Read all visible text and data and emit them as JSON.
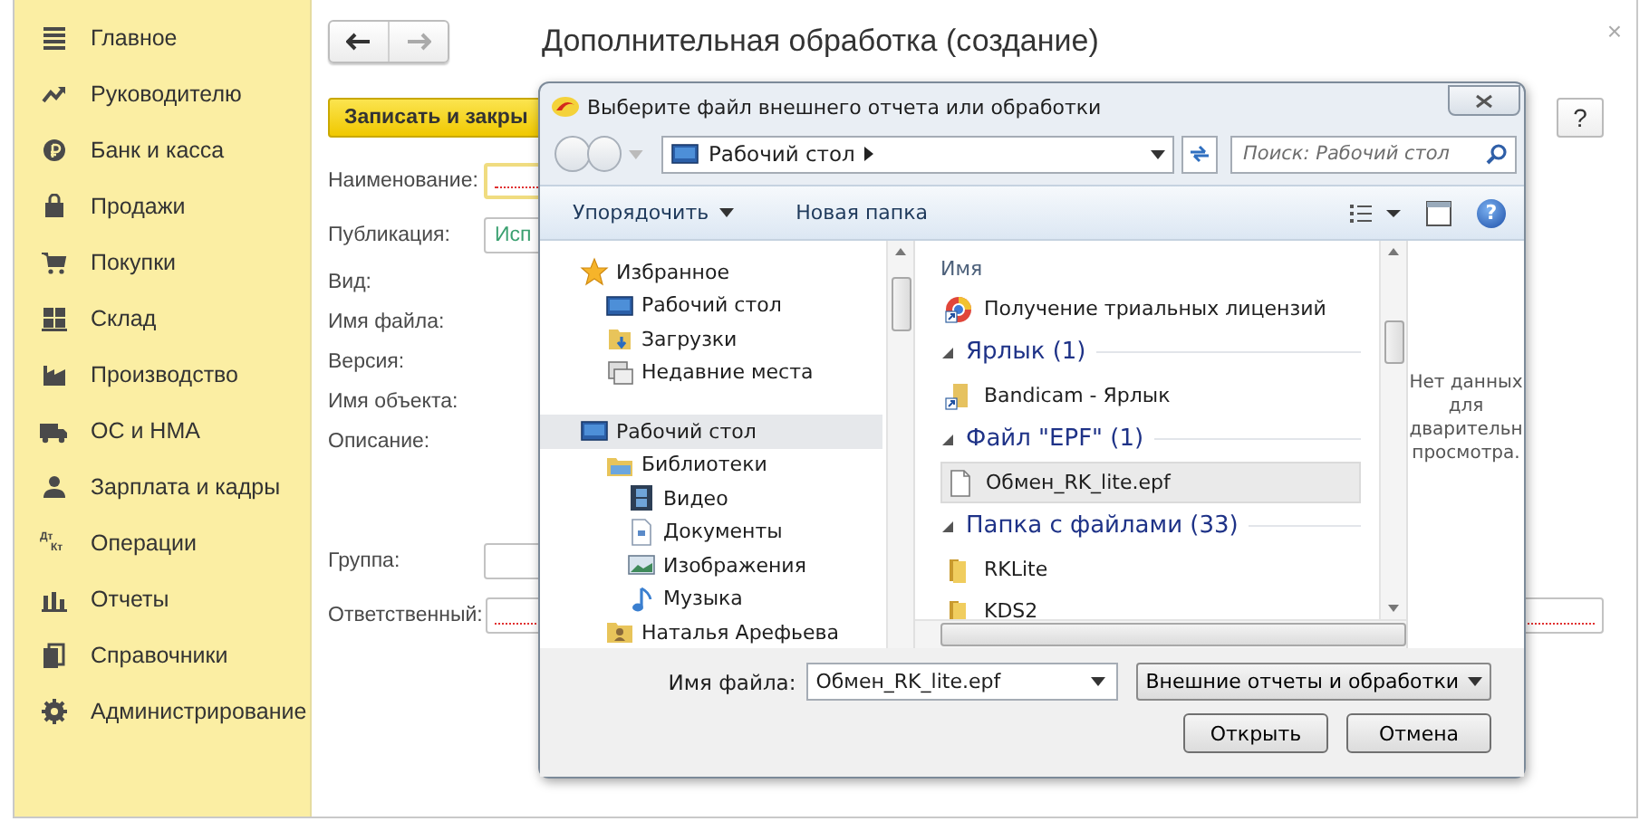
{
  "sidebar": {
    "items": [
      {
        "kind": "menu",
        "label": "Главное"
      },
      {
        "kind": "trend",
        "label": "Руководителю"
      },
      {
        "kind": "coin",
        "label": "Банк и касса"
      },
      {
        "kind": "bag",
        "label": "Продажи"
      },
      {
        "kind": "cart",
        "label": "Покупки"
      },
      {
        "kind": "grid",
        "label": "Склад"
      },
      {
        "kind": "factory",
        "label": "Производство"
      },
      {
        "kind": "truck",
        "label": "ОС и НМА"
      },
      {
        "kind": "person",
        "label": "Зарплата и кадры"
      },
      {
        "kind": "debit-credit",
        "label": "Операции",
        "icon_text": [
          "Дт",
          "Кт"
        ]
      },
      {
        "kind": "bars",
        "label": "Отчеты"
      },
      {
        "kind": "books",
        "label": "Справочники"
      },
      {
        "kind": "gear",
        "label": "Администрирование"
      }
    ]
  },
  "form": {
    "title": "Дополнительная обработка (создание)",
    "close": "×",
    "save_button": "Записать и закры",
    "help_button": "?",
    "fields": [
      {
        "kind": "input",
        "label": "Наименование:",
        "focused": true,
        "required": true
      },
      {
        "kind": "input",
        "label": "Публикация:",
        "value": "Исп",
        "focused": false,
        "required": false
      },
      {
        "kind": "label",
        "label": "Вид:"
      },
      {
        "kind": "label",
        "label": "Имя файла:"
      },
      {
        "kind": "label",
        "label": "Версия:"
      },
      {
        "kind": "label",
        "label": "Имя объекта:"
      },
      {
        "kind": "label",
        "label": "Описание:"
      },
      {
        "kind": "input",
        "label": "Группа:",
        "focused": false,
        "required": false
      },
      {
        "kind": "input",
        "label": "Ответственный:",
        "focused": false,
        "required": true
      }
    ]
  },
  "dialog": {
    "title": "Выберите файл внешнего отчета или обработки",
    "address": "Рабочий стол",
    "search_placeholder": "Поиск: Рабочий стол",
    "toolbar": {
      "organize": "Упорядочить",
      "new_folder": "Новая папка",
      "help": "?"
    },
    "nav": [
      {
        "kind": "favorites",
        "label": "Избранное",
        "selected": false,
        "children": [
          {
            "kind": "desktop",
            "label": "Рабочий стол",
            "selected": false
          },
          {
            "kind": "downloads",
            "label": "Загрузки",
            "selected": false
          },
          {
            "kind": "recent",
            "label": "Недавние места",
            "selected": false
          }
        ]
      },
      {
        "kind": "desktop",
        "label": "Рабочий стол",
        "selected": true,
        "children": [
          {
            "kind": "libraries",
            "label": "Библиотеки",
            "selected": false,
            "children": [
              {
                "kind": "video",
                "label": "Видео",
                "selected": false
              },
              {
                "kind": "documents",
                "label": "Документы",
                "selected": false
              },
              {
                "kind": "pictures",
                "label": "Изображения",
                "selected": false
              },
              {
                "kind": "music",
                "label": "Музыка",
                "selected": false
              }
            ]
          },
          {
            "kind": "user",
            "label": "Наталья Арефьева",
            "selected": false
          }
        ]
      }
    ],
    "list_header": "Имя",
    "list": [
      {
        "kind": "web-shortcut",
        "label": "Получение триальных лицензий",
        "selected": false
      },
      {
        "kind": "group",
        "label": "Ярлык (1)",
        "expanded": true,
        "children": [
          {
            "kind": "shortcut",
            "label": "Bandicam - Ярлык",
            "selected": false
          }
        ]
      },
      {
        "kind": "group",
        "label": "Файл \"EPF\" (1)",
        "expanded": true,
        "children": [
          {
            "kind": "document",
            "label": "Обмен_RK_lite.epf",
            "selected": true
          }
        ]
      },
      {
        "kind": "group",
        "label": "Папка с файлами (33)",
        "expanded": true,
        "children": [
          {
            "kind": "folder",
            "label": "RKLite",
            "selected": false
          },
          {
            "kind": "folder",
            "label": "KDS2",
            "selected": false
          }
        ]
      }
    ],
    "preview": [
      "Нет данных",
      "для",
      "дварительн",
      "просмотра."
    ],
    "filename_label": "Имя файла:",
    "filename": "Обмен_RK_lite.epf",
    "filter": "Внешние отчеты и обработки",
    "open_button": "Открыть",
    "cancel_button": "Отмена"
  }
}
